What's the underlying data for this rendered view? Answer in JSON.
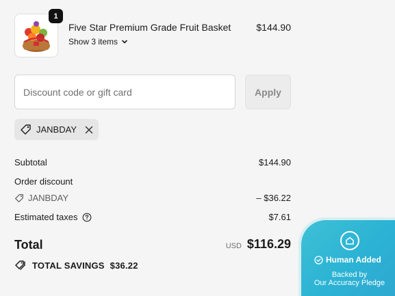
{
  "product": {
    "quantity": "1",
    "name": "Five Star Premium Grade Fruit Basket",
    "show_items": "Show 3 items",
    "price": "$144.90"
  },
  "discount": {
    "placeholder": "Discount code or gift card",
    "apply_label": "Apply",
    "applied_code": "JANBDAY"
  },
  "summary": {
    "subtotal_label": "Subtotal",
    "subtotal_value": "$144.90",
    "order_discount_label": "Order discount",
    "discount_code": "JANBDAY",
    "discount_value": "– $36.22",
    "taxes_label": "Estimated taxes",
    "taxes_value": "$7.61"
  },
  "total": {
    "label": "Total",
    "currency": "USD",
    "amount": "$116.29",
    "savings_label": "TOTAL SAVINGS",
    "savings_value": "$36.22"
  },
  "pledge": {
    "title": "Human Added",
    "line1": "Backed by",
    "line2": "Our Accuracy Pledge"
  }
}
